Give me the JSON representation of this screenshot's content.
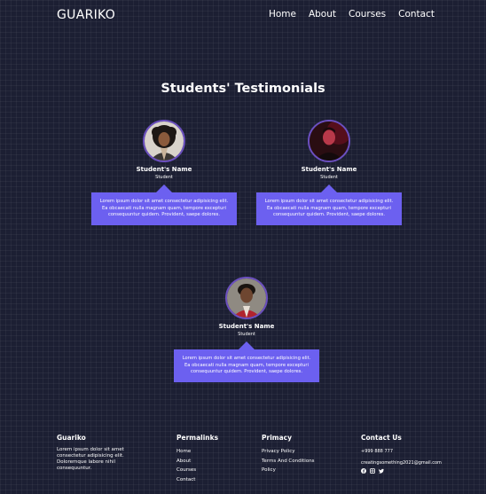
{
  "header": {
    "logo": "GUARIKO",
    "nav": [
      "Home",
      "About",
      "Courses",
      "Contact"
    ]
  },
  "section_title": "Students' Testimonials",
  "testimonials": [
    {
      "name": "Student's Name",
      "role": "Student",
      "text": "Lorem ipsum dolor sit amet consectetur adipisicing elit. Ea obcaecati nulla magnam quam, tempore excepturi consequuntur quidem. Provident, saepe dolores.",
      "avatar_icon": "student-photo-1"
    },
    {
      "name": "Student's Name",
      "role": "Student",
      "text": "Lorem ipsum dolor sit amet consectetur adipisicing elit. Ea obcaecati nulla magnam quam, tempore excepturi consequuntur quidem. Provident, saepe dolores.",
      "avatar_icon": "student-photo-2"
    },
    {
      "name": "Student's Name",
      "role": "Student",
      "text": "Lorem ipsum dolor sit amet consectetur adipisicing elit. Ea obcaecati nulla magnam quam, tempore excepturi consequuntur quidem. Provident, saepe dolores.",
      "avatar_icon": "student-photo-3"
    }
  ],
  "footer": {
    "brand": {
      "title": "Guariko",
      "text": "Lorem ipsum dolor sit amet consectetur adipisicing elit. Doloremque labore nihil consequuntur."
    },
    "permalinks": {
      "title": "Permalinks",
      "links": [
        "Home",
        "About",
        "Courses",
        "Contact"
      ]
    },
    "primacy": {
      "title": "Primacy",
      "links": [
        "Privacy Policy",
        "Terms And Conditions",
        "Policy"
      ]
    },
    "contact": {
      "title": "Contact Us",
      "phone": "+999 888 777",
      "email": "creatingsomething2021@gmail.com",
      "social_icons": [
        "facebook-icon",
        "instagram-icon",
        "twitter-icon"
      ]
    }
  },
  "colors": {
    "background": "#1c1f33",
    "bubble": "#6c60f0",
    "avatar_border": "#6b4fbf"
  }
}
